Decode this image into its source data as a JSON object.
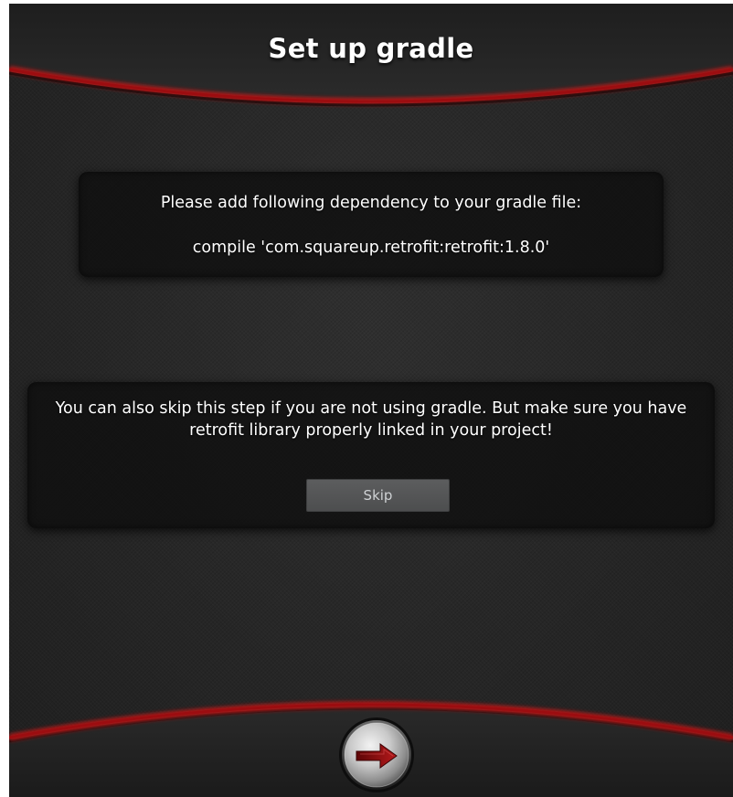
{
  "header": {
    "title": "Set up gradle"
  },
  "dependency_panel": {
    "instruction": "Please add following dependency to your gradle file:",
    "dependency": "compile 'com.squareup.retrofit:retrofit:1.8.0'"
  },
  "skip_panel": {
    "message": "You can also skip this step if you are not using gradle. But make sure you have retrofit library properly linked in your project!",
    "skip_label": "Skip"
  },
  "footer": {
    "next_icon": "arrow-right-icon"
  },
  "colors": {
    "background": "#262626",
    "accent_red": "#b01012",
    "panel": "#0e0e0e",
    "button": "#555657",
    "text": "#ffffff"
  }
}
